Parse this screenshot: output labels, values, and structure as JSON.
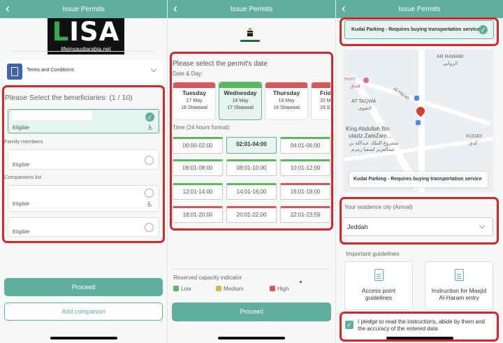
{
  "colors": {
    "teal": "#5fae9e",
    "highlight": "#d9242a",
    "green": "#5bb85d",
    "yellow": "#d8b24a",
    "red": "#d35a5a"
  },
  "screen1": {
    "title": "Issue Permits",
    "logo": {
      "word": "LISA",
      "url": "lifeinsaudiarabia.net"
    },
    "terms_label": "Terms and Conditions",
    "beneficiaries_title": "Please Select the beneficiaries: (1 / 10)",
    "selected_beneficiary_status": "Eligible",
    "family_section": "Family members",
    "family_status": "Eligible",
    "companions_section": "Companions list",
    "companion1_status": "Eligible",
    "companion2_status": "Eligible",
    "proceed_label": "Proceed",
    "add_companion_label": "Add companion"
  },
  "screen2": {
    "title": "Issue Permits",
    "date_title": "Please select the permit's date",
    "date_sub": "Date & Day:",
    "days": [
      {
        "name": "Tuesday",
        "date": "17 May",
        "hijri": "16 Shawwal"
      },
      {
        "name": "Wednesday",
        "date": "18 May",
        "hijri": "17 Shawwal"
      },
      {
        "name": "Thursday",
        "date": "19 May",
        "hijri": "18 Shawwal"
      },
      {
        "name": "Frid",
        "date": "20 M",
        "hijri": "19 Sh"
      }
    ],
    "time_title": "Time (24 hours format):",
    "slots": [
      "00:00-02:00",
      "02:01-04:00",
      "04:01-06:00",
      "06:01-08:00",
      "08:01-10:00",
      "10:01-12:00",
      "12:01-14:00",
      "14:01-16:00",
      "16:01-18:00",
      "18:01-20:00",
      "20:01-22:00",
      "22:01-23:59"
    ],
    "legend_title": "Reserved capacity indicator",
    "legend": [
      "Low",
      "Medium",
      "High"
    ],
    "proceed_label": "Proceed"
  },
  "screen3": {
    "title": "Issue Permits",
    "parking_label": "Kudai Parking - Requires buying transportation service",
    "map_labels": {
      "rawabi": "AR RAWABI",
      "rawabi_ar": "الروابي",
      "hotel": "nium",
      "hotel_ar": "فندق",
      "taqwa": "AT TAQWA",
      "taqwa_ar": "التقوى",
      "hijrah": "Al Hijrah",
      "king": "King Abdullah Bin",
      "king2": "ulaziz ZamZam...",
      "king_ar": "مشروع الملك عبدالله بن",
      "king_ar2": "عبدالعزيز لسقيا زمزم",
      "kuday": "KUDAY",
      "kuday_ar": "كدي"
    },
    "map_card_label": "Kudai Parking - Requires buying transportation service",
    "city_title": "Your residence city (Arrival)",
    "city_value": "Jeddah",
    "guide_title": "Important guidelines",
    "guide1": "Access point guidelines",
    "guide2": "Instruction for Masjid Al-Haram entry",
    "pledge_text": "I pledge to read the instructions, abide by them and the accuracy of the entered data"
  }
}
